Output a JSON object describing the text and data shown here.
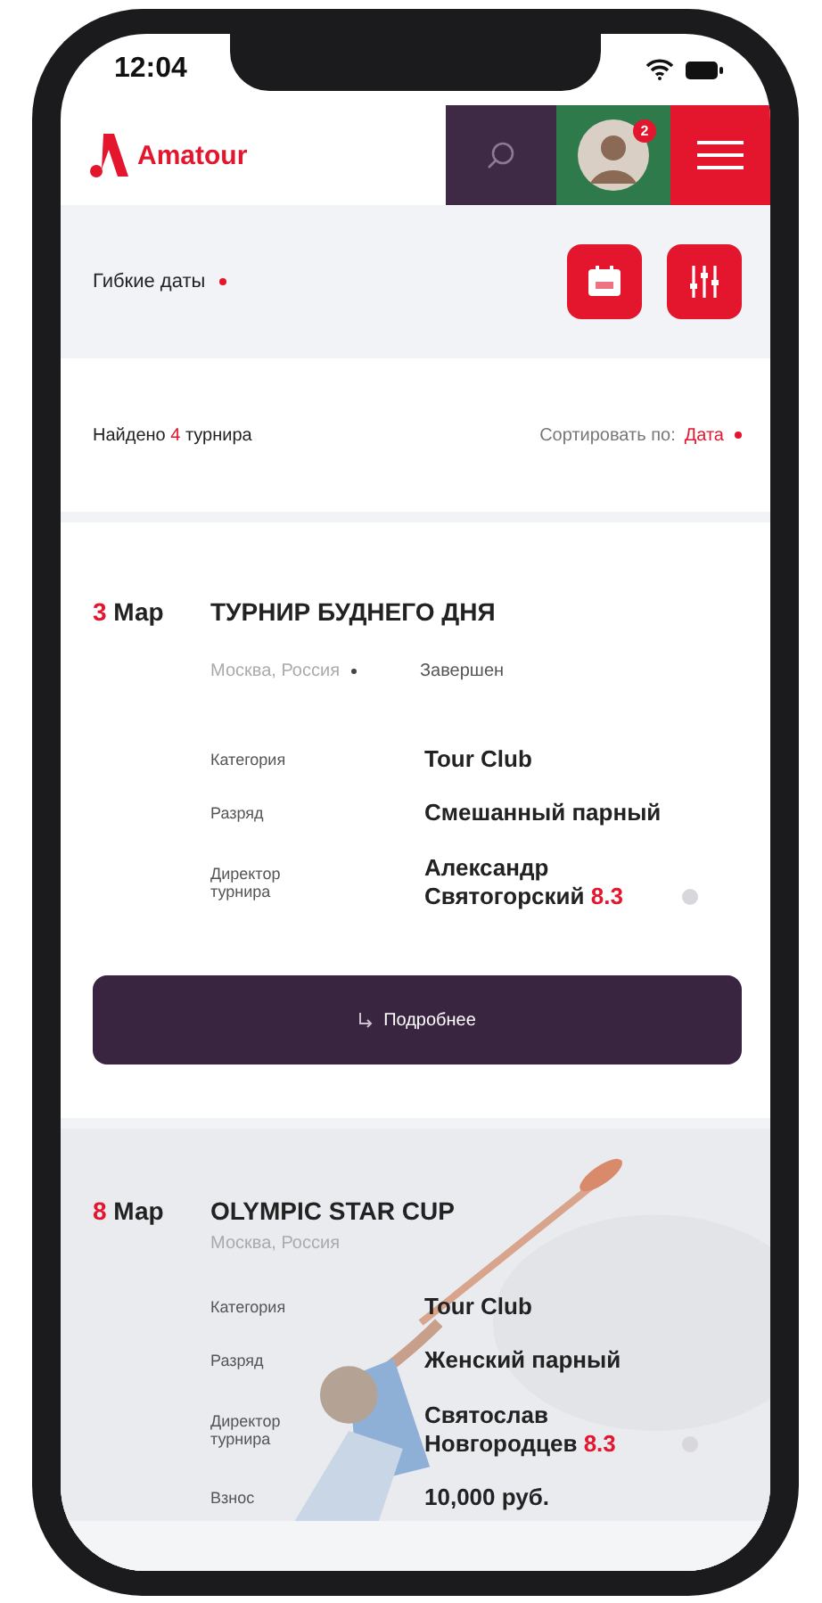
{
  "status_bar": {
    "time": "12:04"
  },
  "header": {
    "logo": "Amatour",
    "notification_count": "2"
  },
  "filters": {
    "label": "Гибкие даты"
  },
  "results": {
    "found_before": "Найдено",
    "found_count": "4",
    "found_after": "турнира",
    "sort_label": "Сортировать по:",
    "sort_value": "Дата"
  },
  "tournaments": [
    {
      "day": "3",
      "month": "Мар",
      "title": "ТУРНИР БУДНЕГО ДНЯ",
      "location": "Москва, Россия",
      "status": "Завершен",
      "kind": "plain",
      "fields": [
        {
          "label": "Категория",
          "value": "Tour Club"
        },
        {
          "label": "Разряд",
          "value": "Смешанный парный"
        },
        {
          "label": "Директор турнира",
          "value": "Александр Святогорский",
          "rating": "8.3"
        }
      ],
      "button": "Подробнее"
    },
    {
      "day": "8",
      "month": "Мар",
      "title": "OLYMPIC STAR CUP",
      "location": "Москва, Россия",
      "kind": "picture",
      "fields": [
        {
          "label": "Категория",
          "value": "Tour Club"
        },
        {
          "label": "Разряд",
          "value": "Женский парный"
        },
        {
          "label": "Директор турнира",
          "value": "Святослав Новгородцев",
          "rating": "8.3"
        },
        {
          "label": "Взнос",
          "value": "10,000 руб."
        }
      ]
    }
  ]
}
